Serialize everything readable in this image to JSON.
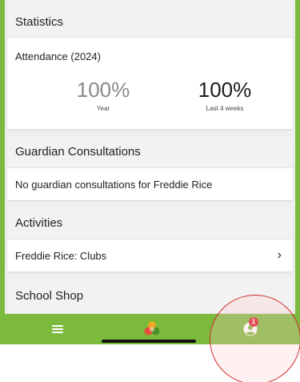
{
  "statistics": {
    "header": "Statistics",
    "attendance_title": "Attendance (2024)",
    "year_value": "100%",
    "year_label": "Year",
    "recent_value": "100%",
    "recent_label": "Last 4 weeks"
  },
  "guardian": {
    "header": "Guardian Consultations",
    "message": "No guardian consultations for Freddie Rice"
  },
  "activities": {
    "header": "Activities",
    "item": "Freddie Rice: Clubs"
  },
  "shop": {
    "header": "School Shop"
  },
  "nav": {
    "notification_count": "1",
    "icons": [
      "menu-icon",
      "logo-icon",
      "profile-icon"
    ]
  },
  "colors": {
    "brand_green": "#7cba3d",
    "badge_red": "#d81f26",
    "highlight_red": "#cf2b2b"
  }
}
